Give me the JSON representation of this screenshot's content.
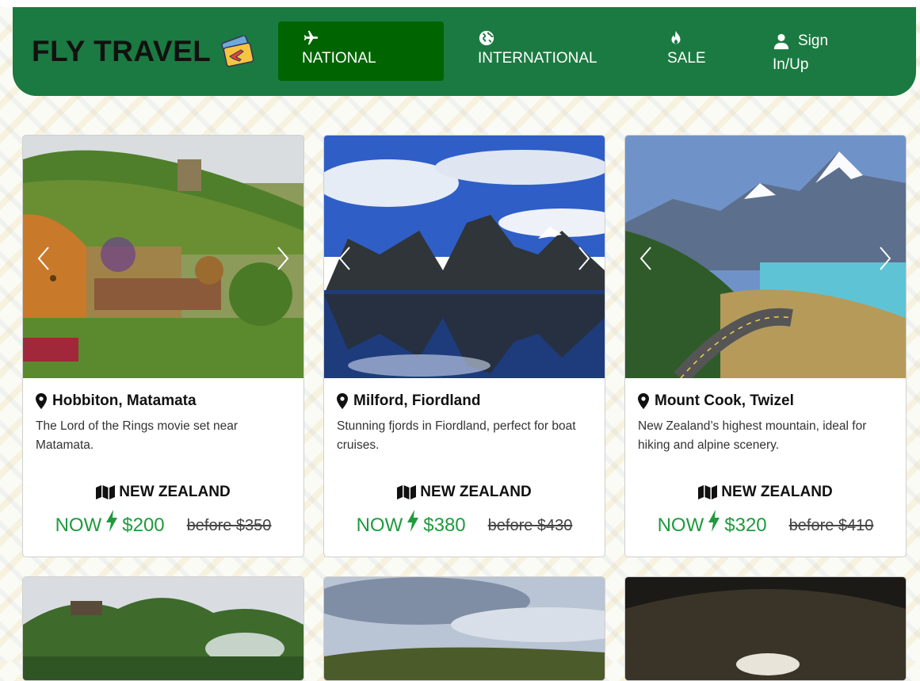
{
  "header": {
    "brand": "FLY TRAVEL",
    "brand_icon": "plane-ticket-icon",
    "nav": [
      {
        "label": "NATIONAL",
        "icon": "plane-icon",
        "active": true
      },
      {
        "label": "INTERNATIONAL",
        "icon": "globe-icon",
        "active": false
      },
      {
        "label": "SALE",
        "icon": "fire-icon",
        "active": false
      },
      {
        "label_line1": "Sign",
        "label_line2": "In/Up",
        "icon": "user-icon",
        "active": false
      }
    ],
    "colors": {
      "bar": "#1b7a41",
      "active_tab": "#006400"
    }
  },
  "cards": [
    {
      "title": "Hobbiton, Matamata",
      "description": "The Lord of the Rings movie set near Matamata.",
      "country": "NEW ZEALAND",
      "now_label": "NOW",
      "price_now": "$200",
      "price_before": "before $350"
    },
    {
      "title": "Milford, Fiordland",
      "description": "Stunning fjords in Fiordland, perfect for boat cruises.",
      "country": "NEW ZEALAND",
      "now_label": "NOW",
      "price_now": "$380",
      "price_before": "before $430"
    },
    {
      "title": "Mount Cook, Twizel",
      "description": "New Zealand’s highest mountain, ideal for hiking and alpine scenery.",
      "country": "NEW ZEALAND",
      "now_label": "NOW",
      "price_now": "$320",
      "price_before": "before $410"
    }
  ],
  "price_color": "#1f9a3e"
}
